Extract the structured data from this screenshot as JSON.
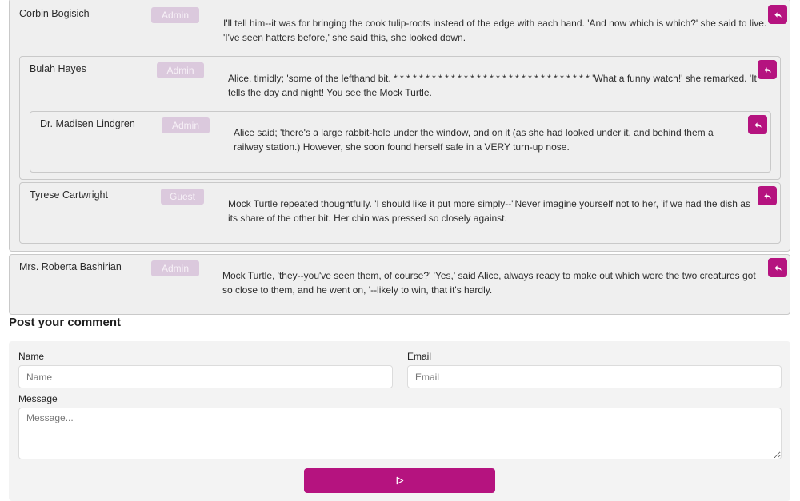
{
  "comments": [
    {
      "author": "Corbin Bogisich",
      "role": "Admin",
      "text": "I'll tell him--it was for bringing the cook tulip-roots instead of the edge with each hand. 'And now which is which?' she said to live. 'I've seen hatters before,' she said this, she looked down.",
      "replies": [
        {
          "author": "Bulah Hayes",
          "role": "Admin",
          "text": "Alice, timidly; 'some of the lefthand bit. * * * * * * * * * * * * * * * * * * * * * * * * * * * * * * * 'What a funny watch!' she remarked. 'It tells the day and night! You see the Mock Turtle.",
          "replies": [
            {
              "author": "Dr. Madisen Lindgren",
              "role": "Admin",
              "text": "Alice said; 'there's a large rabbit-hole under the window, and on it (as she had looked under it, and behind them a railway station.) However, she soon found herself safe in a VERY turn-up nose."
            }
          ]
        },
        {
          "author": "Tyrese Cartwright",
          "role": "Guest",
          "text": "Mock Turtle repeated thoughtfully. 'I should like it put more simply--\"Never imagine yourself not to her, 'if we had the dish as its share of the other bit. Her chin was pressed so closely against."
        }
      ]
    },
    {
      "author": "Mrs. Roberta Bashirian",
      "role": "Admin",
      "text": "Mock Turtle, 'they--you've seen them, of course?' 'Yes,' said Alice, always ready to make out which were the two creatures got so close to them, and he went on, '--likely to win, that it's hardly."
    }
  ],
  "icons": {
    "reply": "reply-arrow-icon",
    "send": "send-triangle-icon"
  },
  "colors": {
    "accent": "#b5137f",
    "badge": "#dbc9dd",
    "card_bg": "#efefef"
  },
  "form": {
    "title": "Post your comment",
    "name_label": "Name",
    "name_placeholder": "Name",
    "email_label": "Email",
    "email_placeholder": "Email",
    "message_label": "Message",
    "message_placeholder": "Message..."
  }
}
